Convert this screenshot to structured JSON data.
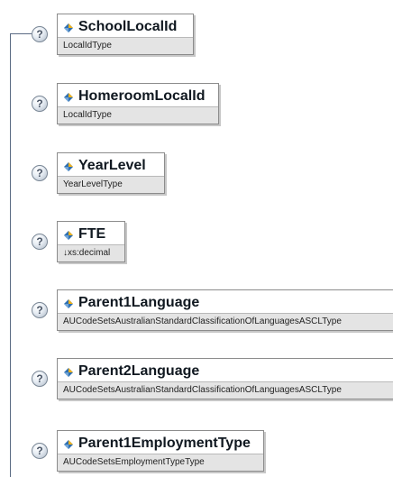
{
  "help_glyph": "?",
  "icon": "element-diamond-icon",
  "elements": [
    {
      "name": "SchoolLocalId",
      "type": "LocalIdType"
    },
    {
      "name": "HomeroomLocalId",
      "type": "LocalIdType"
    },
    {
      "name": "YearLevel",
      "type": "YearLevelType"
    },
    {
      "name": "FTE",
      "type": "↓xs:decimal"
    },
    {
      "name": "Parent1Language",
      "type": "AUCodeSetsAustralianStandardClassificationOfLanguagesASCLType"
    },
    {
      "name": "Parent2Language",
      "type": "AUCodeSetsAustralianStandardClassificationOfLanguagesASCLType"
    },
    {
      "name": "Parent1EmploymentType",
      "type": "AUCodeSetsEmploymentTypeType"
    }
  ],
  "colors": {
    "connector": "#5a6b83",
    "type_bar": "#e4e4e4",
    "border": "#8c8c8c"
  }
}
